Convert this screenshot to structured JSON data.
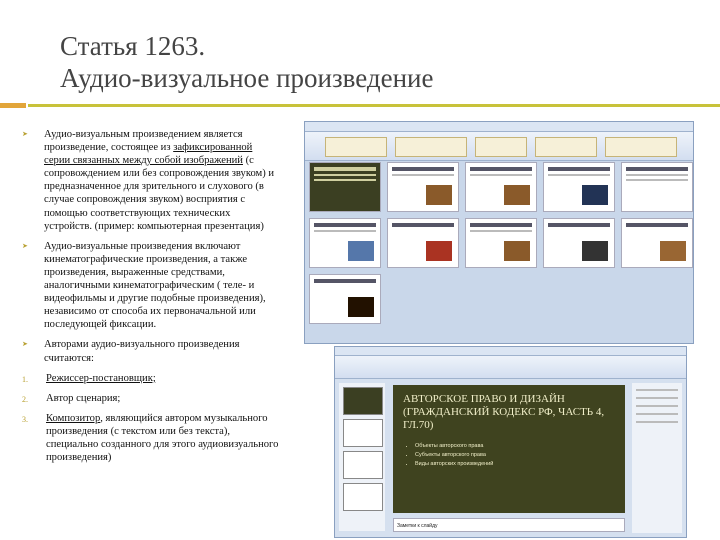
{
  "title": {
    "line1": "Статья 1263.",
    "line2": "Аудио-визуальное произведение"
  },
  "content": {
    "bullet1_pre": "Аудио-визуальным произведением является произведение, состоящее из ",
    "bullet1_underlined": "зафиксированной серии связанных между собой изображений",
    "bullet1_post": " (с сопровождением или без сопровождения звуком) и предназначенное для зрительного и слухового (в случае сопровождения звуком) восприятия с помощью соответствующих технических устройств. (пример: компьютерная презентация)",
    "bullet2": "Аудио-визуальные произведения включают кинематографические произведения, а также произведения, выраженные средствами, аналогичными кинематографическим ( теле- и видеофильмы и другие подобные произведения), независимо от способа их первоначальной или последующей фиксации.",
    "bullet3": "Авторами аудио-визуального произведения считаются:",
    "item1_num": "1.",
    "item1": "Режиссер-постановщик;",
    "item2_num": "2.",
    "item2": "Автор сценария;",
    "item3_num": "3.",
    "item3_underlined": "Композитор",
    "item3_post": ", являющийся автором музыкального произведения (с текстом или без текста), специально созданного для этого аудиовизуального произведения)"
  },
  "screenshot2": {
    "slide_title": "АВТОРСКОЕ ПРАВО И ДИЗАЙН (ГРАЖДАНСКИЙ КОДЕКС РФ, ЧАСТЬ 4, ГЛ.70)",
    "slide_bullets": [
      "Объекты авторского права",
      "Субъекты авторского права",
      "Виды авторских произведений"
    ],
    "notes": "Заметки к слайду"
  },
  "colors": {
    "accent_orange": "#e2a53a",
    "accent_olive": "#c8c23a",
    "slide_dark": "#3f431f"
  }
}
